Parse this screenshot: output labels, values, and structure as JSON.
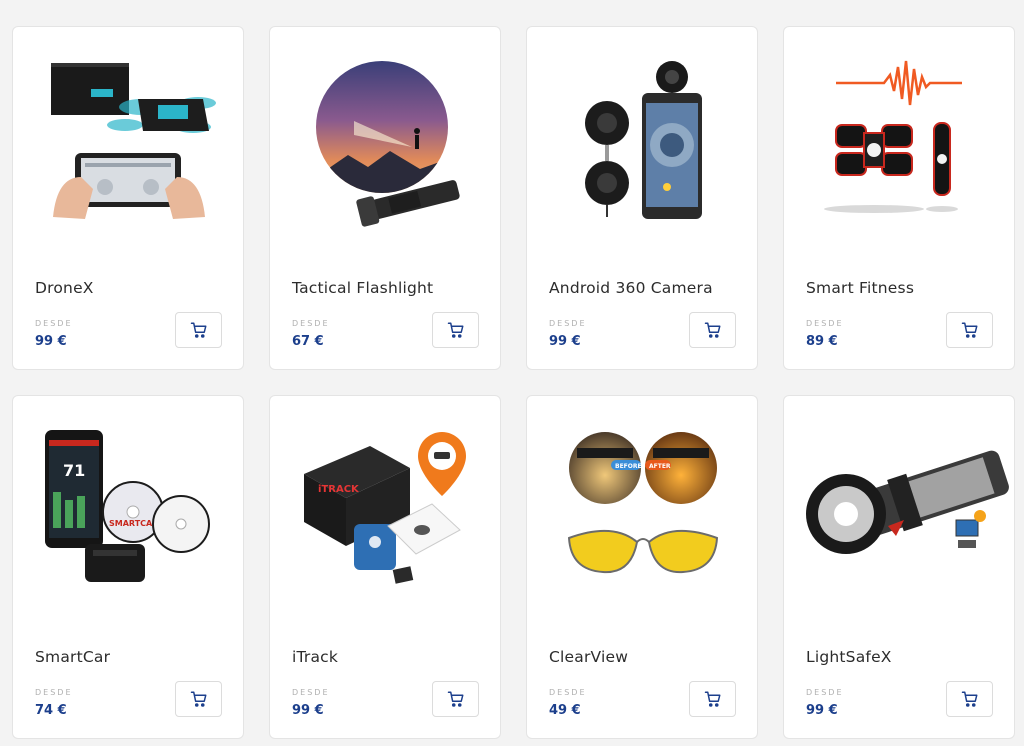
{
  "products": [
    {
      "name": "DroneX",
      "desde": "DESDE",
      "price": "99 €"
    },
    {
      "name": "Tactical Flashlight",
      "desde": "DESDE",
      "price": "67 €"
    },
    {
      "name": "Android 360 Camera",
      "desde": "DESDE",
      "price": "99 €"
    },
    {
      "name": "Smart Fitness",
      "desde": "DESDE",
      "price": "89 €"
    },
    {
      "name": "SmartCar",
      "desde": "DESDE",
      "price": "74 €"
    },
    {
      "name": "iTrack",
      "desde": "DESDE",
      "price": "99 €"
    },
    {
      "name": "ClearView",
      "desde": "DESDE",
      "price": "49 €"
    },
    {
      "name": "LightSafeX",
      "desde": "DESDE",
      "price": "99 €"
    }
  ],
  "image_text": {
    "smartcar_logo": "SMARTCAR",
    "smartcar_speed": "71",
    "itrack_logo": "iTRACK",
    "clearview_before": "BEFORE",
    "clearview_after": "AFTER"
  },
  "colors": {
    "price": "#1c3f8c",
    "cart_icon": "#1c3f8c",
    "background": "#f3f3f3"
  },
  "icons": {
    "cart": "shopping-cart-icon"
  }
}
